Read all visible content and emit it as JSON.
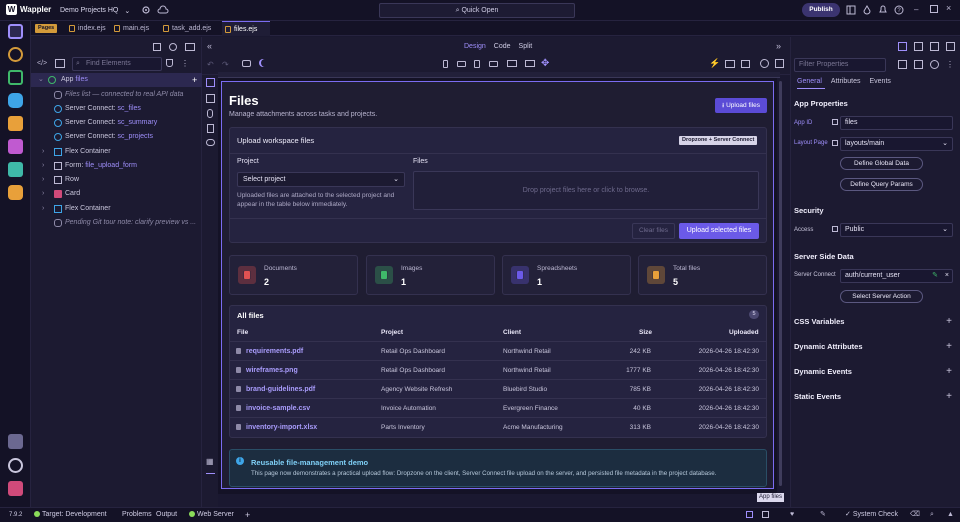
{
  "app": {
    "brand": "Wappler",
    "project": "Demo Projects HQ",
    "quick_open": "Quick Open",
    "publish": "Publish"
  },
  "tabs": {
    "pages_badge": "Pages",
    "items": [
      "index.ejs",
      "main.ejs",
      "task_add.ejs",
      "files.ejs"
    ],
    "active": "files.ejs"
  },
  "tree": {
    "find_placeholder": "Find Elements",
    "items": [
      {
        "label": "App",
        "suffix": "files"
      },
      {
        "label": "Files list — connected to real API data"
      },
      {
        "label": "Server Connect:",
        "suffix": "sc_files"
      },
      {
        "label": "Server Connect:",
        "suffix": "sc_summary"
      },
      {
        "label": "Server Connect:",
        "suffix": "sc_projects"
      },
      {
        "label": "Flex Container"
      },
      {
        "label": "Form:",
        "suffix": "file_upload_form"
      },
      {
        "label": "Row"
      },
      {
        "label": "Card"
      },
      {
        "label": "Flex Container"
      },
      {
        "label": "Pending Git tour note: clarify preview vs ..."
      }
    ]
  },
  "view_modes": {
    "design": "Design",
    "code": "Code",
    "split": "Split"
  },
  "page": {
    "title": "Files",
    "subtitle": "Manage attachments across tasks and projects.",
    "upload_button": "Upload files",
    "upload_card": {
      "title": "Upload workspace files",
      "badge": "Dropzone + Server Connect",
      "project_label": "Project",
      "files_label": "Files",
      "select_value": "Select project",
      "help": "Uploaded files are attached to the selected project and appear in the table below immediately.",
      "dropzone": "Drop project files here or click to browse.",
      "clear": "Clear files",
      "upload_selected": "Upload selected files"
    },
    "stats": [
      {
        "label": "Documents",
        "value": "2",
        "color": "#e05252"
      },
      {
        "label": "Images",
        "value": "1",
        "color": "#3fb96a"
      },
      {
        "label": "Spreadsheets",
        "value": "1",
        "color": "#6b5ae8"
      },
      {
        "label": "Total files",
        "value": "5",
        "color": "#e8a03a"
      }
    ],
    "table": {
      "title": "All files",
      "count": "5",
      "headers": [
        "File",
        "Project",
        "Client",
        "Size",
        "Uploaded"
      ],
      "rows": [
        [
          "requirements.pdf",
          "Retail Ops Dashboard",
          "Northwind Retail",
          "242 KB",
          "2026-04-26 18:42:30"
        ],
        [
          "wireframes.png",
          "Retail Ops Dashboard",
          "Northwind Retail",
          "1777 KB",
          "2026-04-26 18:42:30"
        ],
        [
          "brand-guidelines.pdf",
          "Agency Website Refresh",
          "Bluebird Studio",
          "785 KB",
          "2026-04-26 18:42:30"
        ],
        [
          "invoice-sample.csv",
          "Invoice Automation",
          "Evergreen Finance",
          "40 KB",
          "2026-04-26 18:42:30"
        ],
        [
          "inventory-import.xlsx",
          "Parts Inventory",
          "Acme Manufacturing",
          "313 KB",
          "2026-04-26 18:42:30"
        ]
      ]
    },
    "info": {
      "title": "Reusable file-management demo",
      "text": "This page now demonstrates a practical upload flow: Dropzone on the client, Server Connect file upload on the server, and persisted file metadata in the project database."
    },
    "selected_tag": "App files"
  },
  "props": {
    "filter_placeholder": "Filter Properties",
    "tabs": [
      "General",
      "Attributes",
      "Events"
    ],
    "app_properties": "App Properties",
    "app_id_label": "App ID",
    "app_id": "files",
    "layout_label": "Layout Page",
    "layout_value": "layouts/main",
    "define_global": "Define Global Data",
    "define_query": "Define Query Params",
    "security": "Security",
    "access_label": "Access",
    "access_value": "Public",
    "server_side": "Server Side Data",
    "server_connect_label": "Server Connect",
    "server_connect_value": "auth/current_user",
    "select_action": "Select Server Action",
    "sections": [
      "CSS Variables",
      "Dynamic Attributes",
      "Dynamic Events",
      "Static Events"
    ]
  },
  "status": {
    "version": "7.9.2",
    "target": "Target: Development",
    "problems": "Problems",
    "output": "Output",
    "web_server": "Web Server",
    "system_check": "System Check"
  }
}
